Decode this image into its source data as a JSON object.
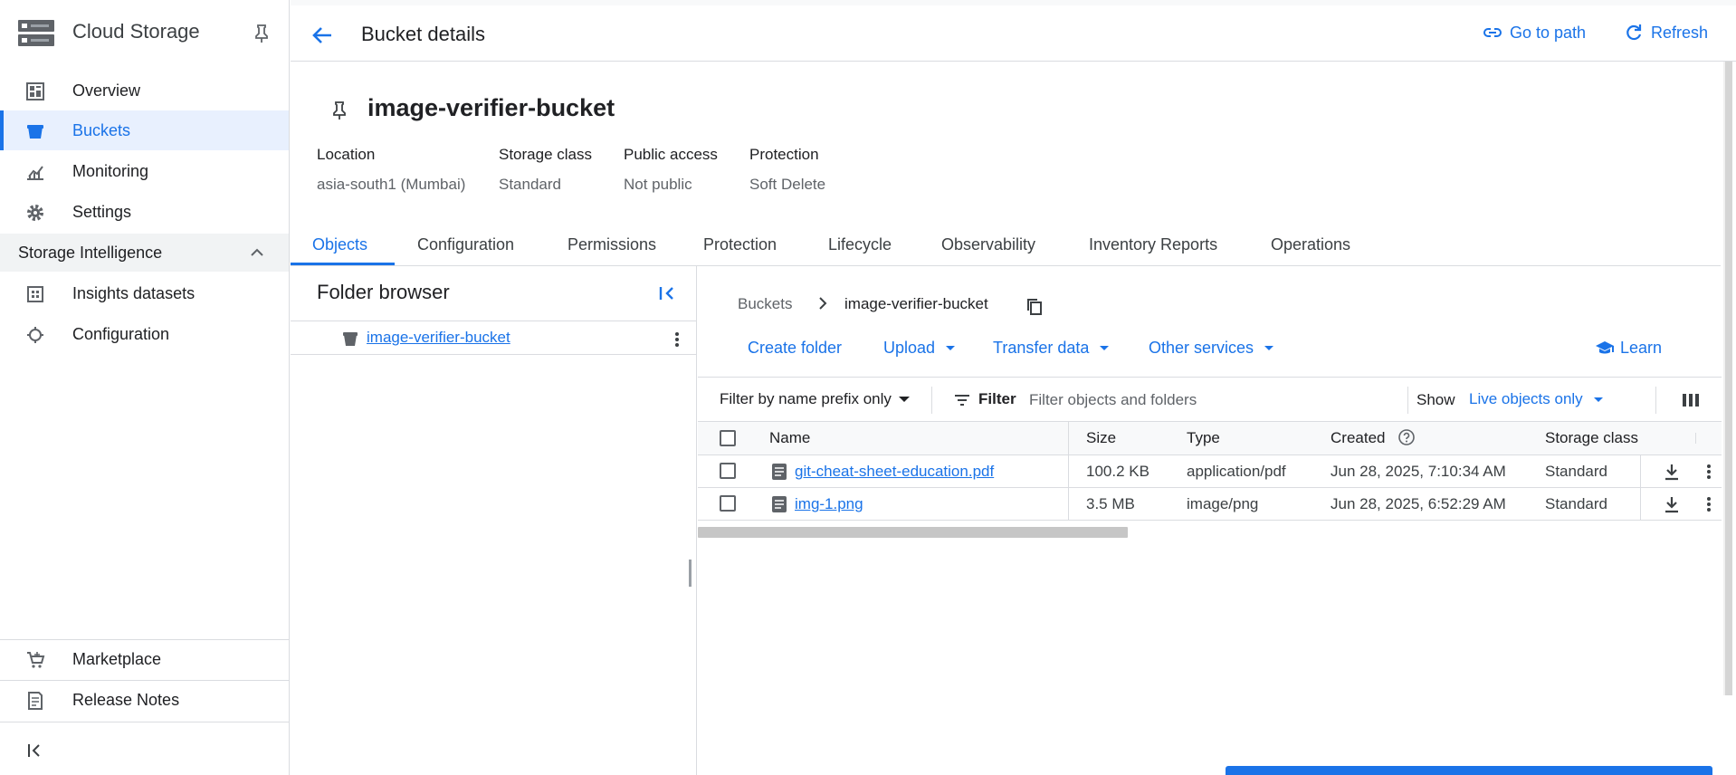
{
  "sidebar": {
    "title": "Cloud Storage",
    "items": [
      {
        "label": "Overview",
        "icon": "dashboard-icon"
      },
      {
        "label": "Buckets",
        "icon": "bucket-icon",
        "active": true
      },
      {
        "label": "Monitoring",
        "icon": "chart-icon"
      },
      {
        "label": "Settings",
        "icon": "gear-icon"
      }
    ],
    "section": {
      "label": "Storage Intelligence",
      "expanded": true
    },
    "section_items": [
      {
        "label": "Insights datasets",
        "icon": "dataset-icon"
      },
      {
        "label": "Configuration",
        "icon": "config-icon"
      }
    ],
    "bottom_items": [
      {
        "label": "Marketplace",
        "icon": "cart-icon"
      },
      {
        "label": "Release Notes",
        "icon": "notes-icon"
      }
    ]
  },
  "header": {
    "title": "Bucket details",
    "go_to_path": "Go to path",
    "refresh": "Refresh"
  },
  "bucket": {
    "name": "image-verifier-bucket",
    "meta": [
      {
        "key": "Location",
        "value": "asia-south1 (Mumbai)"
      },
      {
        "key": "Storage class",
        "value": "Standard"
      },
      {
        "key": "Public access",
        "value": "Not public"
      },
      {
        "key": "Protection",
        "value": "Soft Delete"
      }
    ]
  },
  "tabs": [
    "Objects",
    "Configuration",
    "Permissions",
    "Protection",
    "Lifecycle",
    "Observability",
    "Inventory Reports",
    "Operations"
  ],
  "active_tab": "Objects",
  "folder_browser": {
    "title": "Folder browser",
    "items": [
      "image-verifier-bucket"
    ]
  },
  "breadcrumb": {
    "root": "Buckets",
    "current": "image-verifier-bucket"
  },
  "actions": {
    "create_folder": "Create folder",
    "upload": "Upload",
    "transfer": "Transfer data",
    "other": "Other services",
    "learn": "Learn"
  },
  "filter": {
    "prefix_mode": "Filter by name prefix only",
    "label": "Filter",
    "placeholder": "Filter objects and folders",
    "show_label": "Show",
    "show_value": "Live objects only"
  },
  "table": {
    "columns": [
      "Name",
      "Size",
      "Type",
      "Created",
      "Storage class"
    ],
    "rows": [
      {
        "name": "git-cheat-sheet-education.pdf",
        "size": "100.2 KB",
        "type": "application/pdf",
        "created": "Jun 28, 2025, 7:10:34 AM",
        "storage_class": "Standard"
      },
      {
        "name": "img-1.png",
        "size": "3.5 MB",
        "type": "image/png",
        "created": "Jun 28, 2025, 6:52:29 AM",
        "storage_class": "Standard"
      }
    ]
  },
  "colors": {
    "accent": "#1a73e8",
    "active_bg": "#e8f0fe",
    "border": "#dadce0"
  }
}
